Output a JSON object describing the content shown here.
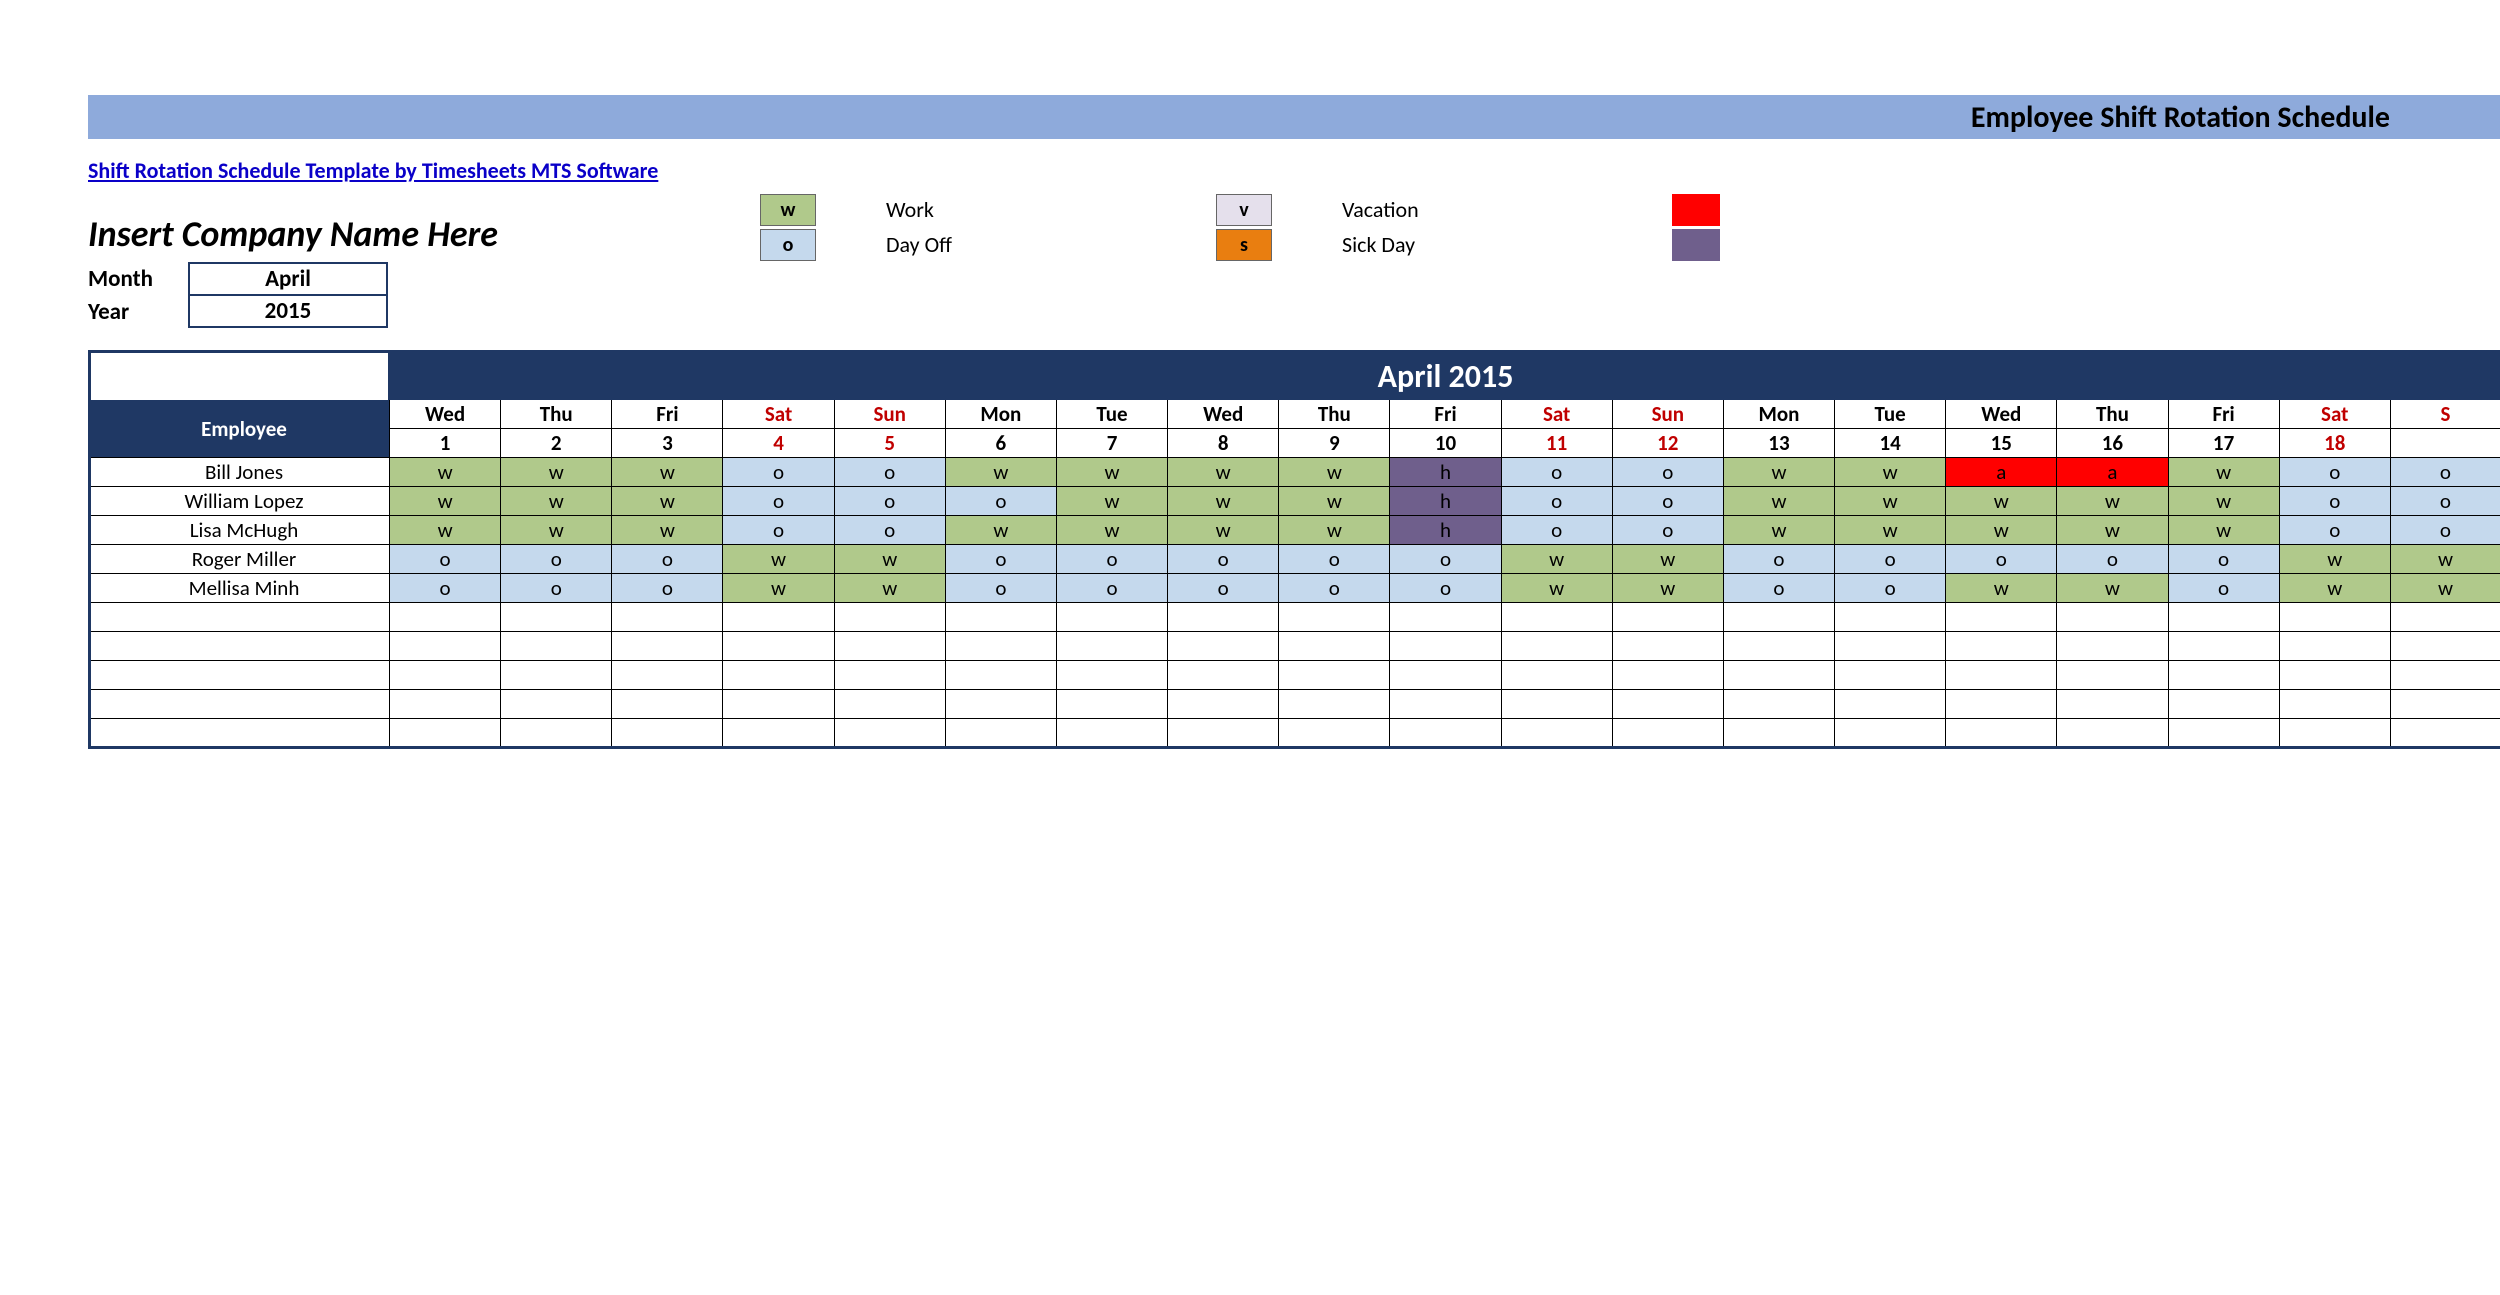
{
  "banner_title": "Employee Shift Rotation Schedule",
  "template_link": "Shift Rotation Schedule Template by Timesheets MTS Software",
  "company_placeholder": "Insert Company Name Here",
  "month_label": "Month",
  "year_label": "Year",
  "month_value": "April",
  "year_value": "2015",
  "month_header": "April 2015",
  "legend": [
    {
      "code": "w",
      "label": "Work",
      "class": "c-w"
    },
    {
      "code": "o",
      "label": "Day Off",
      "class": "c-o"
    },
    {
      "code": "v",
      "label": "Vacation",
      "class": "c-v"
    },
    {
      "code": "s",
      "label": "Sick Day",
      "class": "c-s"
    }
  ],
  "employee_header": "Employee",
  "days": [
    {
      "dow": "Wed",
      "num": "1",
      "we": false
    },
    {
      "dow": "Thu",
      "num": "2",
      "we": false
    },
    {
      "dow": "Fri",
      "num": "3",
      "we": false
    },
    {
      "dow": "Sat",
      "num": "4",
      "we": true
    },
    {
      "dow": "Sun",
      "num": "5",
      "we": true
    },
    {
      "dow": "Mon",
      "num": "6",
      "we": false
    },
    {
      "dow": "Tue",
      "num": "7",
      "we": false
    },
    {
      "dow": "Wed",
      "num": "8",
      "we": false
    },
    {
      "dow": "Thu",
      "num": "9",
      "we": false
    },
    {
      "dow": "Fri",
      "num": "10",
      "we": false
    },
    {
      "dow": "Sat",
      "num": "11",
      "we": true
    },
    {
      "dow": "Sun",
      "num": "12",
      "we": true
    },
    {
      "dow": "Mon",
      "num": "13",
      "we": false
    },
    {
      "dow": "Tue",
      "num": "14",
      "we": false
    },
    {
      "dow": "Wed",
      "num": "15",
      "we": false
    },
    {
      "dow": "Thu",
      "num": "16",
      "we": false
    },
    {
      "dow": "Fri",
      "num": "17",
      "we": false
    },
    {
      "dow": "Sat",
      "num": "18",
      "we": true
    },
    {
      "dow": "S",
      "num": "",
      "we": true
    }
  ],
  "rows": [
    {
      "name": "Bill Jones",
      "cells": [
        "w",
        "w",
        "w",
        "o",
        "o",
        "w",
        "w",
        "w",
        "w",
        "h",
        "o",
        "o",
        "w",
        "w",
        "a",
        "a",
        "w",
        "o",
        "o"
      ]
    },
    {
      "name": "William Lopez",
      "cells": [
        "w",
        "w",
        "w",
        "o",
        "o",
        "o",
        "w",
        "w",
        "w",
        "h",
        "o",
        "o",
        "w",
        "w",
        "w",
        "w",
        "w",
        "o",
        "o"
      ]
    },
    {
      "name": "Lisa McHugh",
      "cells": [
        "w",
        "w",
        "w",
        "o",
        "o",
        "w",
        "w",
        "w",
        "w",
        "h",
        "o",
        "o",
        "w",
        "w",
        "w",
        "w",
        "w",
        "o",
        "o"
      ]
    },
    {
      "name": "Roger Miller",
      "cells": [
        "o",
        "o",
        "o",
        "w",
        "w",
        "o",
        "o",
        "o",
        "o",
        "o",
        "w",
        "w",
        "o",
        "o",
        "o",
        "o",
        "o",
        "w",
        "w"
      ]
    },
    {
      "name": "Mellisa Minh",
      "cells": [
        "o",
        "o",
        "o",
        "w",
        "w",
        "o",
        "o",
        "o",
        "o",
        "o",
        "w",
        "w",
        "o",
        "o",
        "w",
        "w",
        "o",
        "w",
        "w"
      ]
    }
  ],
  "empty_rows": 5
}
